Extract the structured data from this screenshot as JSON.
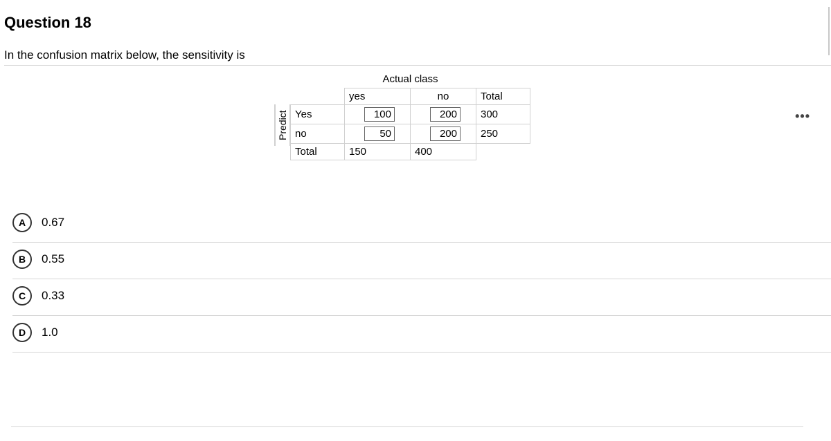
{
  "question": {
    "title": "Question 18",
    "prompt": "In the confusion matrix below, the sensitivity is"
  },
  "matrix": {
    "row_axis_label": "Predict",
    "col_axis_label": "Actual class",
    "col_headers": {
      "c1": "yes",
      "c2": "no",
      "total": "Total"
    },
    "row_headers": {
      "r1": "Yes",
      "r2": "no",
      "total": "Total"
    },
    "cells": {
      "r1c1": "100",
      "r1c2": "200",
      "r1total": "300",
      "r2c1": "50",
      "r2c2": "200",
      "r2total": "250",
      "tc1": "150",
      "tc2": "400"
    }
  },
  "options": {
    "A": {
      "letter": "A",
      "text": "0.67"
    },
    "B": {
      "letter": "B",
      "text": "0.55"
    },
    "C": {
      "letter": "C",
      "text": "0.33"
    },
    "D": {
      "letter": "D",
      "text": "1.0"
    }
  },
  "icons": {
    "more": "•••"
  }
}
